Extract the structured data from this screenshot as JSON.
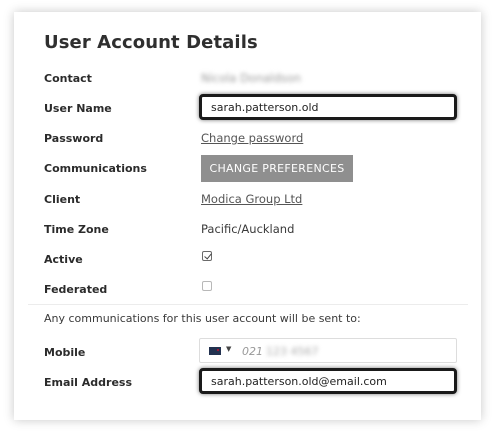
{
  "page": {
    "title": "User Account Details",
    "notice": "Any communications for this user account will be sent to:"
  },
  "labels": {
    "contact": "Contact",
    "username": "User Name",
    "password": "Password",
    "communications": "Communications",
    "client": "Client",
    "timezone": "Time Zone",
    "active": "Active",
    "federated": "Federated",
    "mobile": "Mobile",
    "email": "Email Address"
  },
  "values": {
    "contact": "Nicola Donaldson",
    "username": "sarah.patterson.old",
    "password_link": "Change password",
    "communications_button": "CHANGE PREFERENCES",
    "client_link": "Modica Group Ltd",
    "timezone": "Pacific/Auckland",
    "active": true,
    "federated": false,
    "mobile_prefix": "021",
    "mobile_rest": "123 4567",
    "email": "sarah.patterson.old@email.com"
  },
  "icons": {
    "country_flag": "nz-flag-icon",
    "dropdown_caret": "chevron-down-icon",
    "caret_glyph": "▼"
  },
  "colors": {
    "button_bg": "#8f8f8f",
    "highlight_border": "#1a1a1a"
  }
}
